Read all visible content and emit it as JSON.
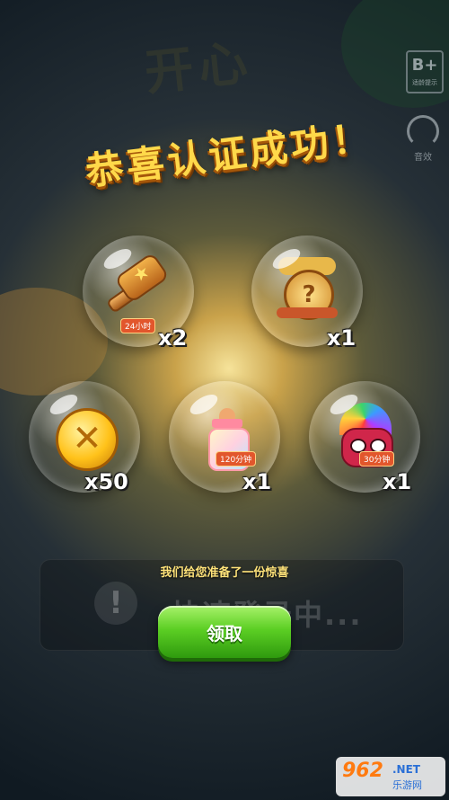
{
  "header": {
    "title": "恭喜认证成功！",
    "age_rating": "B+",
    "age_rating_note": "适龄提示",
    "sound_label": "音效"
  },
  "rewards": [
    {
      "name": "hammer",
      "count": "x2",
      "tag": "24小时"
    },
    {
      "name": "mystery-box",
      "count": "x1"
    },
    {
      "name": "coin",
      "count": "x50"
    },
    {
      "name": "bottle",
      "count": "x1",
      "tag": "120分钟"
    },
    {
      "name": "monster",
      "count": "x1",
      "tag": "30分钟"
    }
  ],
  "gift_panel": {
    "subtitle": "我们给您准备了一份惊喜",
    "background_text": "快速登录中..."
  },
  "claim_button": {
    "label": "领取"
  },
  "watermark": {
    "number": "962",
    "domain": ".NET",
    "name": "乐游网"
  },
  "colors": {
    "title": "#ffd94a",
    "button": "#5ccf24",
    "subtitle": "#ffe37a"
  }
}
